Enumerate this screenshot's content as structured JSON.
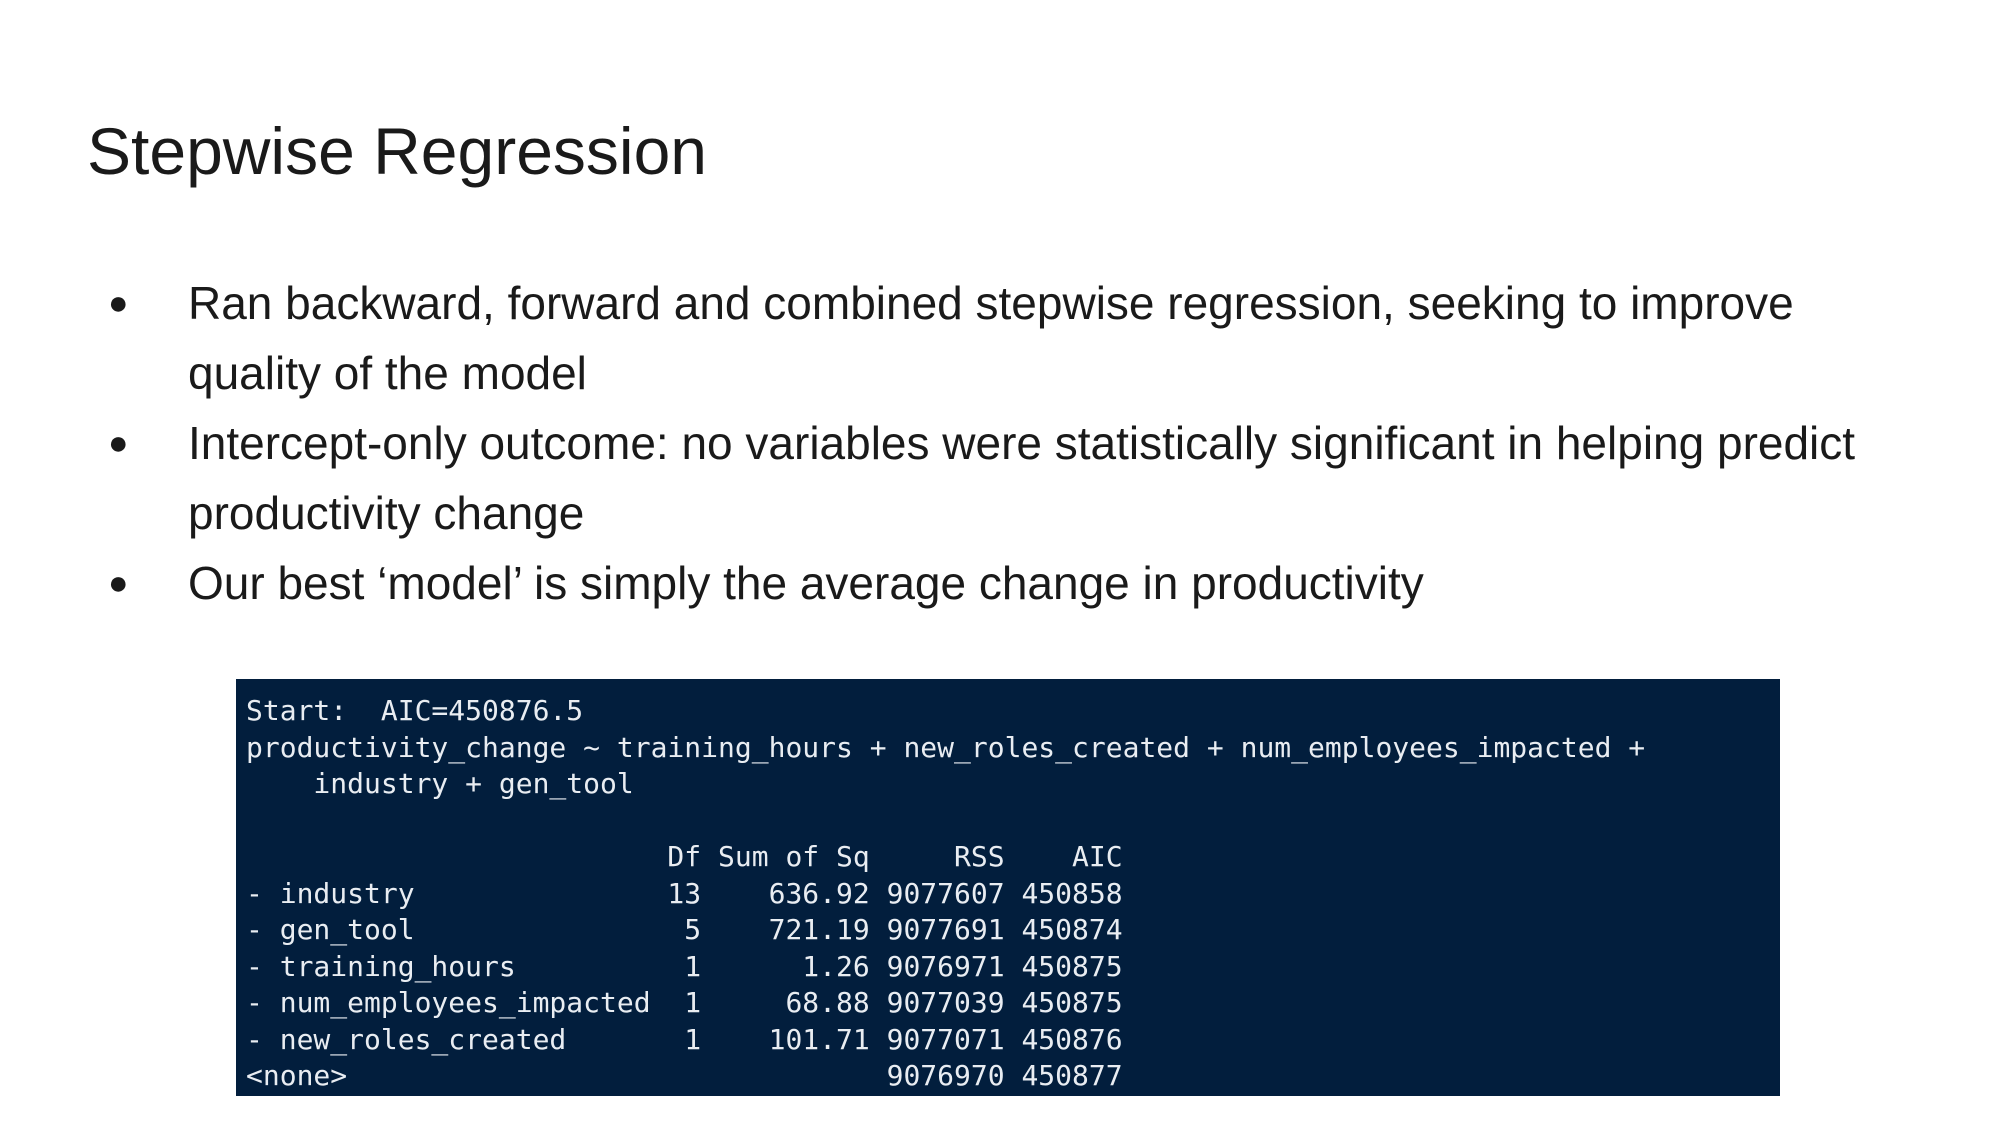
{
  "slide": {
    "title": "Stepwise Regression",
    "bullet_symbol": "●",
    "bullets": [
      "Ran backward, forward and combined stepwise regression, seeking to improve quality of the model",
      "Intercept-only outcome: no variables were statistically significant in helping predict productivity change",
      "Our best ‘model’ is simply the average change in productivity"
    ]
  },
  "console": {
    "background_color": "#021e3d",
    "text_color": "#e9edf2",
    "lines": [
      "Start:  AIC=450876.5",
      "productivity_change ~ training_hours + new_roles_created + num_employees_impacted +",
      "    industry + gen_tool",
      "",
      "                         Df Sum of Sq     RSS    AIC",
      "- industry               13    636.92 9077607 450858",
      "- gen_tool                5    721.19 9077691 450874",
      "- training_hours          1      1.26 9076971 450875",
      "- num_employees_impacted  1     68.88 9077039 450875",
      "- new_roles_created       1    101.71 9077071 450876",
      "<none>                                9076970 450877"
    ]
  }
}
